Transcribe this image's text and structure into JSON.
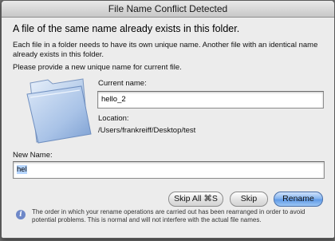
{
  "window": {
    "title": "File Name Conflict Detected"
  },
  "dialog": {
    "heading": "A file of the same name already exists in this folder.",
    "explanation": "Each file in a folder needs to have its own unique name. Another file with an identical name already exists in this folder.",
    "prompt": "Please provide a new unique name for current file."
  },
  "current": {
    "label": "Current name:",
    "value": "hello_2"
  },
  "location": {
    "label": "Location:",
    "value": "/Users/frankreiff/Desktop/test"
  },
  "new_name": {
    "label": "New Name:",
    "value": "hel"
  },
  "buttons": {
    "skip_all": "Skip All ⌘S",
    "skip": "Skip",
    "rename": "Rename"
  },
  "footer": {
    "icon": "info-icon",
    "text": "The order in which your rename operations are carried out has been rearranged in order to avoid potential problems. This is normal and will not interfere with the actual file names."
  },
  "colors": {
    "default_button": "#5d98e6",
    "selection": "#b5d5ff"
  }
}
